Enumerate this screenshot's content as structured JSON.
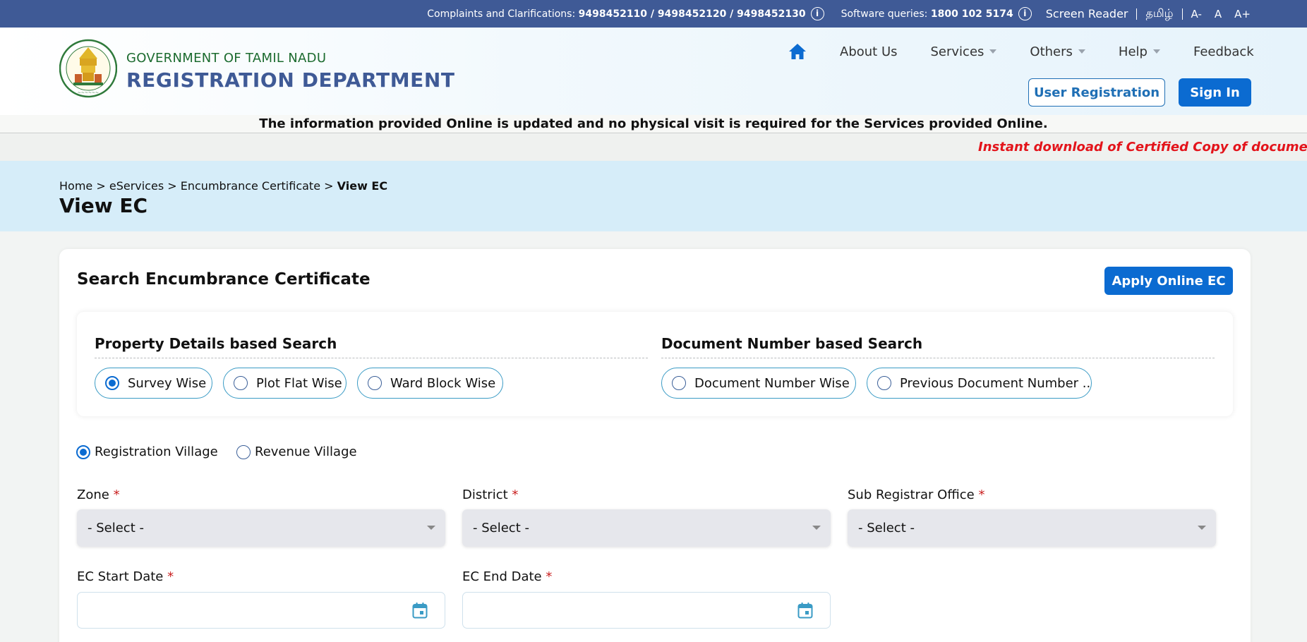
{
  "topbar": {
    "complaints_label": "Complaints and Clarifications:",
    "complaints_numbers": "9498452110 / 9498452120 / 9498452130",
    "software_label": "Software queries:",
    "software_number": "1800 102 5174",
    "screen_reader": "Screen Reader",
    "tamil": "தமிழ்",
    "font_decrease": "A-",
    "font_normal": "A",
    "font_increase": "A+"
  },
  "header": {
    "gov_line": "GOVERNMENT OF TAMIL NADU",
    "dept_line": "REGISTRATION DEPARTMENT",
    "nav": [
      "About Us",
      "Services",
      "Others",
      "Help",
      "Feedback"
    ],
    "user_registration": "User Registration",
    "sign_in": "Sign In"
  },
  "notice": "The information provided Online is updated and no physical visit is required for the Services provided Online.",
  "marquee": "Instant download of Certified Copy of document - M",
  "breadcrumb": {
    "items": [
      "Home",
      "eServices",
      "Encumbrance Certificate"
    ],
    "current": "View EC",
    "separator": ">"
  },
  "page_title": "View EC",
  "card": {
    "title": "Search Encumbrance Certificate",
    "apply_button": "Apply Online EC",
    "property_group_title": "Property Details based Search",
    "property_options": [
      "Survey Wise",
      "Plot Flat Wise",
      "Ward Block Wise"
    ],
    "document_group_title": "Document Number based Search",
    "document_options": [
      "Document Number Wise",
      "Previous Document Number .."
    ],
    "selected_search": "Survey Wise",
    "village_options": [
      "Registration Village",
      "Revenue Village"
    ],
    "selected_village": "Registration Village",
    "fields": {
      "zone_label": "Zone",
      "district_label": "District",
      "sro_label": "Sub Registrar Office",
      "select_placeholder": "- Select -",
      "ec_start_label": "EC Start Date",
      "ec_end_label": "EC End Date",
      "required_mark": "*"
    }
  },
  "colors": {
    "topbar": "#3f5a96",
    "primary_button": "#0b6bd1",
    "banner": "#d6edf9",
    "marquee_text": "#e3141b",
    "required": "#c91f1f"
  }
}
